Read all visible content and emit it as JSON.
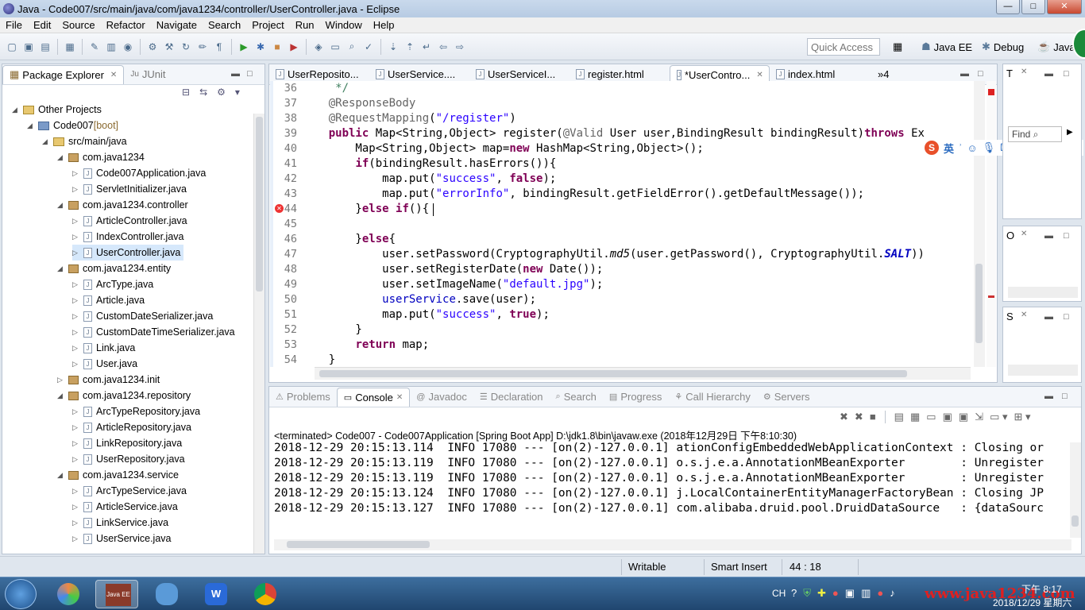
{
  "window": {
    "title": "Java - Code007/src/main/java/com/java1234/controller/UserController.java - Eclipse",
    "buttons": {
      "minimize": "—",
      "maximize": "□",
      "close": "✕"
    }
  },
  "menu": [
    "File",
    "Edit",
    "Source",
    "Refactor",
    "Navigate",
    "Search",
    "Project",
    "Run",
    "Window",
    "Help"
  ],
  "toolbar": {
    "quick_access": "Quick Access",
    "perspectives": [
      "Java EE",
      "Debug",
      "Java"
    ]
  },
  "package_explorer": {
    "tabs": [
      "Package Explorer",
      "JUnit"
    ],
    "tree": [
      {
        "label": "Other Projects",
        "depth": 0,
        "type": "folder",
        "expanded": true
      },
      {
        "label": "Code007",
        "suffix": " [boot]",
        "depth": 1,
        "type": "project",
        "expanded": true
      },
      {
        "label": "src/main/java",
        "depth": 2,
        "type": "srcfolder",
        "expanded": true
      },
      {
        "label": "com.java1234",
        "depth": 3,
        "type": "package",
        "expanded": true
      },
      {
        "label": "Code007Application.java",
        "depth": 4,
        "type": "java"
      },
      {
        "label": "ServletInitializer.java",
        "depth": 4,
        "type": "java"
      },
      {
        "label": "com.java1234.controller",
        "depth": 3,
        "type": "package",
        "expanded": true
      },
      {
        "label": "ArticleController.java",
        "depth": 4,
        "type": "java"
      },
      {
        "label": "IndexController.java",
        "depth": 4,
        "type": "java"
      },
      {
        "label": "UserController.java",
        "depth": 4,
        "type": "java",
        "selected": true
      },
      {
        "label": "com.java1234.entity",
        "depth": 3,
        "type": "package",
        "expanded": true
      },
      {
        "label": "ArcType.java",
        "depth": 4,
        "type": "java"
      },
      {
        "label": "Article.java",
        "depth": 4,
        "type": "java"
      },
      {
        "label": "CustomDateSerializer.java",
        "depth": 4,
        "type": "java"
      },
      {
        "label": "CustomDateTimeSerializer.java",
        "depth": 4,
        "type": "java"
      },
      {
        "label": "Link.java",
        "depth": 4,
        "type": "java"
      },
      {
        "label": "User.java",
        "depth": 4,
        "type": "java"
      },
      {
        "label": "com.java1234.init",
        "depth": 3,
        "type": "package",
        "expanded": false
      },
      {
        "label": "com.java1234.repository",
        "depth": 3,
        "type": "package",
        "expanded": true
      },
      {
        "label": "ArcTypeRepository.java",
        "depth": 4,
        "type": "java"
      },
      {
        "label": "ArticleRepository.java",
        "depth": 4,
        "type": "java"
      },
      {
        "label": "LinkRepository.java",
        "depth": 4,
        "type": "java"
      },
      {
        "label": "UserRepository.java",
        "depth": 4,
        "type": "java"
      },
      {
        "label": "com.java1234.service",
        "depth": 3,
        "type": "package",
        "expanded": true
      },
      {
        "label": "ArcTypeService.java",
        "depth": 4,
        "type": "java"
      },
      {
        "label": "ArticleService.java",
        "depth": 4,
        "type": "java"
      },
      {
        "label": "LinkService.java",
        "depth": 4,
        "type": "java"
      },
      {
        "label": "UserService.java",
        "depth": 4,
        "type": "java"
      }
    ]
  },
  "editor": {
    "tabs": [
      {
        "label": "UserReposito...",
        "active": false
      },
      {
        "label": "UserService....",
        "active": false
      },
      {
        "label": "UserServiceI...",
        "active": false
      },
      {
        "label": "register.html",
        "active": false
      },
      {
        "label": "*UserContro...",
        "active": true
      },
      {
        "label": "index.html",
        "active": false
      }
    ],
    "overflow": "»4",
    "first_line": 36,
    "lines": [
      [
        [
          "cmt",
          "     */"
        ]
      ],
      [
        [
          "",
          "    "
        ],
        [
          "ann",
          "@ResponseBody"
        ]
      ],
      [
        [
          "",
          "    "
        ],
        [
          "ann",
          "@RequestMapping"
        ],
        [
          "",
          "("
        ],
        [
          "str",
          "\"/register\""
        ],
        [
          "",
          ")"
        ]
      ],
      [
        [
          "",
          "    "
        ],
        [
          "kw",
          "public"
        ],
        [
          "",
          " Map<String,Object> register("
        ],
        [
          "ann",
          "@Valid"
        ],
        [
          "",
          " User "
        ],
        [
          "",
          "user"
        ],
        [
          "",
          ",BindingResult "
        ],
        [
          "",
          "bindingResult"
        ],
        [
          "",
          ")"
        ],
        [
          "kw",
          "throws"
        ],
        [
          "",
          " Ex"
        ]
      ],
      [
        [
          "",
          "        Map<String,Object> "
        ],
        [
          "",
          "map"
        ],
        [
          "",
          "="
        ],
        [
          "kw",
          "new"
        ],
        [
          "",
          " HashMap<String,Object>();"
        ]
      ],
      [
        [
          "",
          "        "
        ],
        [
          "kw",
          "if"
        ],
        [
          "",
          "("
        ],
        [
          "",
          "bindingResult"
        ],
        [
          "",
          ".hasErrors()){"
        ]
      ],
      [
        [
          "",
          "            "
        ],
        [
          "",
          "map"
        ],
        [
          "",
          ".put("
        ],
        [
          "str",
          "\"success\""
        ],
        [
          "",
          ", "
        ],
        [
          "kw",
          "false"
        ],
        [
          "",
          ");"
        ]
      ],
      [
        [
          "",
          "            "
        ],
        [
          "",
          "map"
        ],
        [
          "",
          ".put("
        ],
        [
          "str",
          "\"errorInfo\""
        ],
        [
          "",
          ", "
        ],
        [
          "",
          "bindingResult"
        ],
        [
          "",
          ".getFieldError().getDefaultMessage());"
        ]
      ],
      [
        [
          "",
          "        }"
        ],
        [
          "kw",
          "else"
        ],
        [
          "",
          " "
        ],
        [
          "kw",
          "if"
        ],
        [
          "",
          "()"
        ],
        [
          "",
          "{"
        ]
      ],
      [
        [
          "",
          ""
        ]
      ],
      [
        [
          "",
          "        }"
        ],
        [
          "kw",
          "else"
        ],
        [
          "",
          "{"
        ]
      ],
      [
        [
          "",
          "            "
        ],
        [
          "",
          "user"
        ],
        [
          "",
          ".setPassword(CryptographyUtil."
        ],
        [
          "it",
          "md5"
        ],
        [
          "",
          "("
        ],
        [
          "",
          "user"
        ],
        [
          "",
          ".getPassword(), CryptographyUtil."
        ],
        [
          "fldit",
          "SALT"
        ],
        [
          "",
          "))"
        ]
      ],
      [
        [
          "",
          "            "
        ],
        [
          "",
          "user"
        ],
        [
          "",
          ".setRegisterDate("
        ],
        [
          "kw",
          "new"
        ],
        [
          "",
          " Date());"
        ]
      ],
      [
        [
          "",
          "            "
        ],
        [
          "",
          "user"
        ],
        [
          "",
          ".setImageName("
        ],
        [
          "str",
          "\"default.jpg\""
        ],
        [
          "",
          ");"
        ]
      ],
      [
        [
          "",
          "            "
        ],
        [
          "fld",
          "userService"
        ],
        [
          "",
          ".save("
        ],
        [
          "",
          "user"
        ],
        [
          "",
          ");"
        ]
      ],
      [
        [
          "",
          "            "
        ],
        [
          "",
          "map"
        ],
        [
          "",
          ".put("
        ],
        [
          "str",
          "\"success\""
        ],
        [
          "",
          ", "
        ],
        [
          "kw",
          "true"
        ],
        [
          "",
          ");"
        ]
      ],
      [
        [
          "",
          "        }"
        ]
      ],
      [
        [
          "",
          "        "
        ],
        [
          "kw",
          "return"
        ],
        [
          "",
          " "
        ],
        [
          "",
          "map"
        ],
        [
          "",
          ";"
        ]
      ],
      [
        [
          "",
          "    }"
        ]
      ]
    ]
  },
  "right_panels": {
    "top": {
      "tab": "T",
      "find": "Find"
    },
    "mid": {
      "tab": "O"
    },
    "bot": {
      "tab": "S"
    }
  },
  "bottom": {
    "tabs": [
      "Problems",
      "Console",
      "Javadoc",
      "Declaration",
      "Search",
      "Progress",
      "Call Hierarchy",
      "Servers"
    ],
    "active_tab": "Console",
    "terminated": "<terminated> Code007 - Code007Application [Spring Boot App] D:\\jdk1.8\\bin\\javaw.exe (2018年12月29日 下午8:10:30)",
    "console_lines": [
      "2018-12-29 20:15:13.114  INFO 17080 --- [on(2)-127.0.0.1] ationConfigEmbeddedWebApplicationContext : Closing or",
      "2018-12-29 20:15:13.119  INFO 17080 --- [on(2)-127.0.0.1] o.s.j.e.a.AnnotationMBeanExporter        : Unregister",
      "2018-12-29 20:15:13.119  INFO 17080 --- [on(2)-127.0.0.1] o.s.j.e.a.AnnotationMBeanExporter        : Unregister",
      "2018-12-29 20:15:13.124  INFO 17080 --- [on(2)-127.0.0.1] j.LocalContainerEntityManagerFactoryBean : Closing JP",
      "2018-12-29 20:15:13.127  INFO 17080 --- [on(2)-127.0.0.1] com.alibaba.druid.pool.DruidDataSource   : {dataSourc"
    ]
  },
  "status": {
    "writable": "Writable",
    "insert_mode": "Smart Insert",
    "position": "44 : 18"
  },
  "ime": {
    "label": "英"
  },
  "taskbar": {
    "tray_lang": "CH",
    "clock_time": "下午 8:17",
    "clock_date": "2018/12/29 星期六",
    "watermark": "www.java1234.com",
    "java_ee_label": "Java EE"
  },
  "colors": {
    "keyword": "#7f0055",
    "string": "#2a00ff",
    "annotation": "#646464",
    "field": "#0000c0",
    "selection": "#cfe0f5"
  }
}
